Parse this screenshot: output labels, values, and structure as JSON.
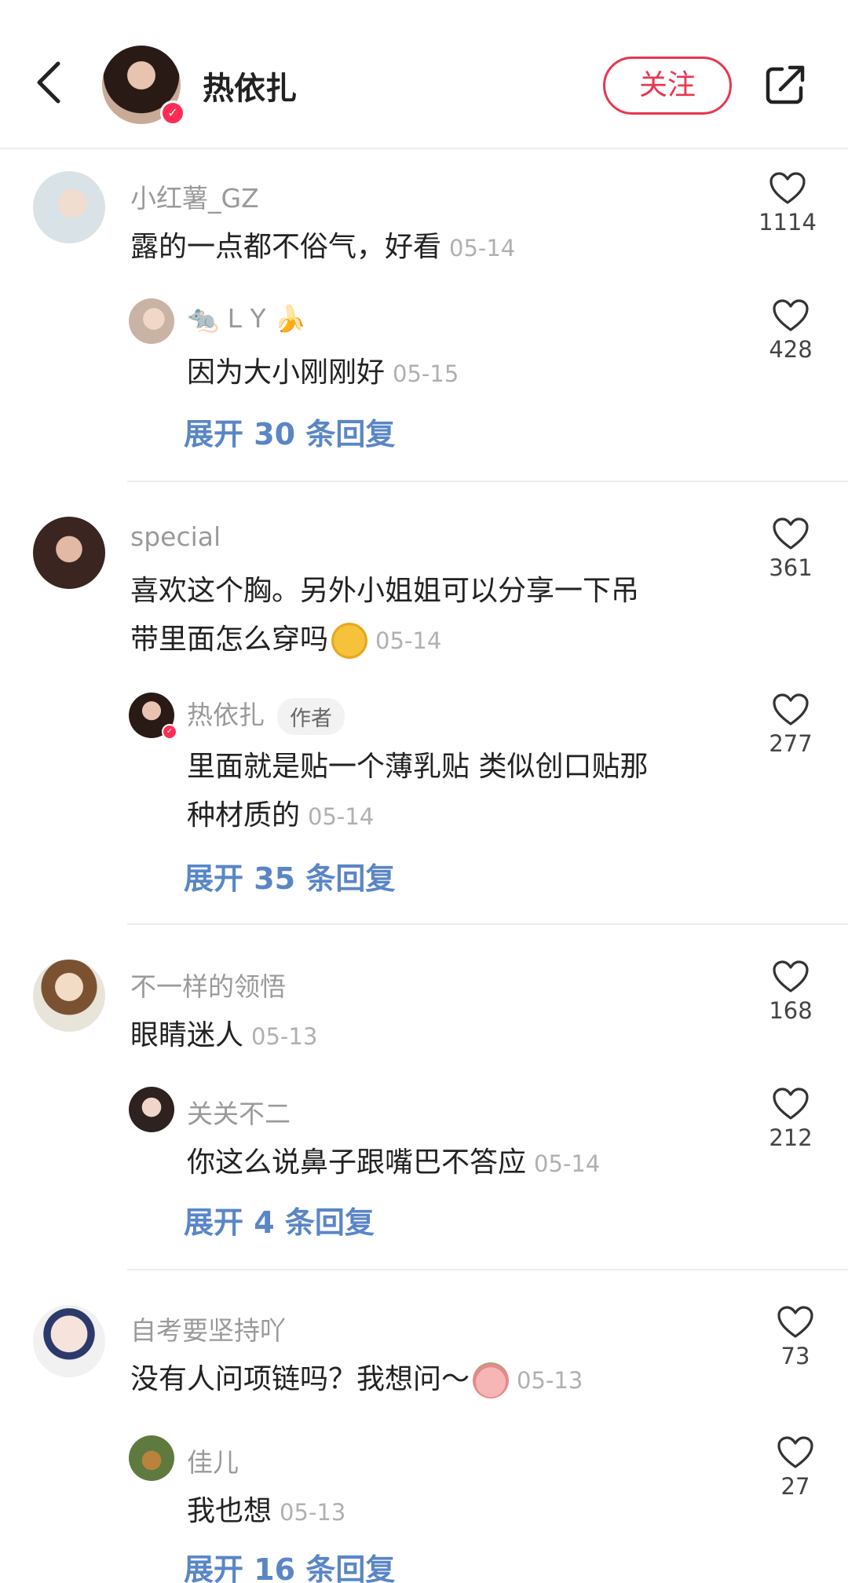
{
  "header": {
    "name": "热依扎",
    "follow_label": "关注"
  },
  "comments": [
    {
      "user": "小红薯_GZ",
      "text": "露的一点都不俗气，好看",
      "date": "05-14",
      "likes": "1114",
      "reply": {
        "user": "🐀 L Y 🍌",
        "text": "因为大小刚刚好",
        "date": "05-15",
        "likes": "428"
      },
      "expand": "展开 30 条回复"
    },
    {
      "user": "special",
      "text_line1": "喜欢这个胸。另外小姐姐可以分享一下吊",
      "text_line2": "带里面怎么穿吗",
      "date": "05-14",
      "likes": "361",
      "reply": {
        "user": "热依扎",
        "tag": "作者",
        "text_line1": "里面就是贴一个薄乳贴 类似创口贴那",
        "text_line2": "种材质的",
        "date": "05-14",
        "likes": "277"
      },
      "expand": "展开 35 条回复"
    },
    {
      "user": "不一样的领悟",
      "text": "眼睛迷人",
      "date": "05-13",
      "likes": "168",
      "reply": {
        "user": "关关不二",
        "text": "你这么说鼻子跟嘴巴不答应",
        "date": "05-14",
        "likes": "212"
      },
      "expand": "展开 4 条回复"
    },
    {
      "user": "自考要坚持吖",
      "text": "没有人问项链吗？我想问～",
      "date": "05-13",
      "likes": "73",
      "reply": {
        "user": "佳儿",
        "text": "我也想",
        "date": "05-13",
        "likes": "27"
      },
      "expand": "展开 16 条回复"
    }
  ],
  "icons": {
    "back": "chevron-left-icon",
    "share": "share-external-icon",
    "like": "heart-outline-icon",
    "verified": "verified-badge-icon"
  },
  "colors": {
    "accent": "#e8364f",
    "link": "#5a86c6",
    "muted": "#9a9a9a"
  }
}
